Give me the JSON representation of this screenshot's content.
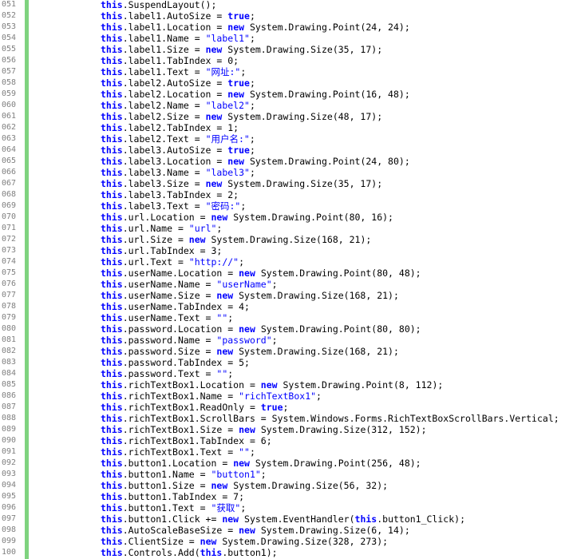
{
  "lines": [
    {
      "n": "051",
      "t": "this.SuspendLayout();"
    },
    {
      "n": "052",
      "t": "this.label1.AutoSize = true;"
    },
    {
      "n": "053",
      "t": "this.label1.Location = new System.Drawing.Point(24, 24);"
    },
    {
      "n": "054",
      "t": "this.label1.Name = \"label1\";"
    },
    {
      "n": "055",
      "t": "this.label1.Size = new System.Drawing.Size(35, 17);"
    },
    {
      "n": "056",
      "t": "this.label1.TabIndex = 0;"
    },
    {
      "n": "057",
      "t": "this.label1.Text = \"网址:\";"
    },
    {
      "n": "058",
      "t": "this.label2.AutoSize = true;"
    },
    {
      "n": "059",
      "t": "this.label2.Location = new System.Drawing.Point(16, 48);"
    },
    {
      "n": "060",
      "t": "this.label2.Name = \"label2\";"
    },
    {
      "n": "061",
      "t": "this.label2.Size = new System.Drawing.Size(48, 17);"
    },
    {
      "n": "062",
      "t": "this.label2.TabIndex = 1;"
    },
    {
      "n": "063",
      "t": "this.label2.Text = \"用户名:\";"
    },
    {
      "n": "064",
      "t": "this.label3.AutoSize = true;"
    },
    {
      "n": "065",
      "t": "this.label3.Location = new System.Drawing.Point(24, 80);"
    },
    {
      "n": "066",
      "t": "this.label3.Name = \"label3\";"
    },
    {
      "n": "067",
      "t": "this.label3.Size = new System.Drawing.Size(35, 17);"
    },
    {
      "n": "068",
      "t": "this.label3.TabIndex = 2;"
    },
    {
      "n": "069",
      "t": "this.label3.Text = \"密码:\";"
    },
    {
      "n": "070",
      "t": "this.url.Location = new System.Drawing.Point(80, 16);"
    },
    {
      "n": "071",
      "t": "this.url.Name = \"url\";"
    },
    {
      "n": "072",
      "t": "this.url.Size = new System.Drawing.Size(168, 21);"
    },
    {
      "n": "073",
      "t": "this.url.TabIndex = 3;"
    },
    {
      "n": "074",
      "t": "this.url.Text = \"http://\";"
    },
    {
      "n": "075",
      "t": "this.userName.Location = new System.Drawing.Point(80, 48);"
    },
    {
      "n": "076",
      "t": "this.userName.Name = \"userName\";"
    },
    {
      "n": "077",
      "t": "this.userName.Size = new System.Drawing.Size(168, 21);"
    },
    {
      "n": "078",
      "t": "this.userName.TabIndex = 4;"
    },
    {
      "n": "079",
      "t": "this.userName.Text = \"\";"
    },
    {
      "n": "080",
      "t": "this.password.Location = new System.Drawing.Point(80, 80);"
    },
    {
      "n": "081",
      "t": "this.password.Name = \"password\";"
    },
    {
      "n": "082",
      "t": "this.password.Size = new System.Drawing.Size(168, 21);"
    },
    {
      "n": "083",
      "t": "this.password.TabIndex = 5;"
    },
    {
      "n": "084",
      "t": "this.password.Text = \"\";"
    },
    {
      "n": "085",
      "t": "this.richTextBox1.Location = new System.Drawing.Point(8, 112);"
    },
    {
      "n": "086",
      "t": "this.richTextBox1.Name = \"richTextBox1\";"
    },
    {
      "n": "087",
      "t": "this.richTextBox1.ReadOnly = true;"
    },
    {
      "n": "088",
      "t": "this.richTextBox1.ScrollBars = System.Windows.Forms.RichTextBoxScrollBars.Vertical;"
    },
    {
      "n": "089",
      "t": "this.richTextBox1.Size = new System.Drawing.Size(312, 152);"
    },
    {
      "n": "090",
      "t": "this.richTextBox1.TabIndex = 6;"
    },
    {
      "n": "091",
      "t": "this.richTextBox1.Text = \"\";"
    },
    {
      "n": "092",
      "t": "this.button1.Location = new System.Drawing.Point(256, 48);"
    },
    {
      "n": "093",
      "t": "this.button1.Name = \"button1\";"
    },
    {
      "n": "094",
      "t": "this.button1.Size = new System.Drawing.Size(56, 32);"
    },
    {
      "n": "095",
      "t": "this.button1.TabIndex = 7;"
    },
    {
      "n": "096",
      "t": "this.button1.Text = \"获取\";"
    },
    {
      "n": "097",
      "t": "this.button1.Click += new System.EventHandler(this.button1_Click);"
    },
    {
      "n": "098",
      "t": "this.AutoScaleBaseSize = new System.Drawing.Size(6, 14);"
    },
    {
      "n": "099",
      "t": "this.ClientSize = new System.Drawing.Size(328, 273);"
    },
    {
      "n": "100",
      "t": "this.Controls.Add(this.button1);"
    }
  ]
}
